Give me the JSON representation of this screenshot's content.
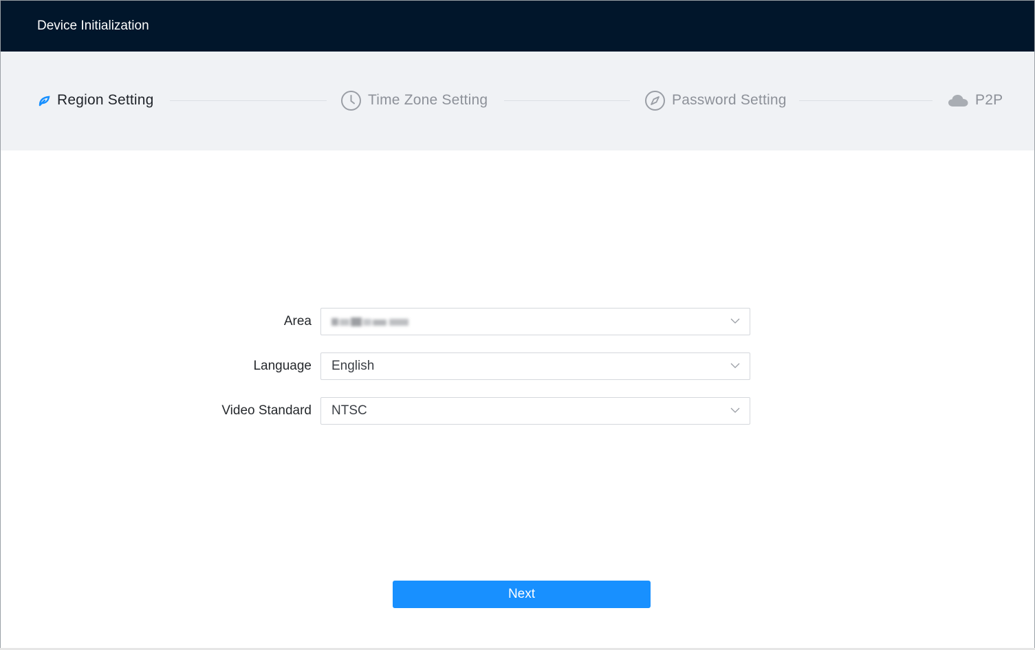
{
  "window": {
    "title": "Device Initialization"
  },
  "steps": [
    {
      "label": "Region Setting",
      "icon": "leaf-icon",
      "active": true
    },
    {
      "label": "Time Zone Setting",
      "icon": "clock-icon",
      "active": false
    },
    {
      "label": "Password Setting",
      "icon": "compass-icon",
      "active": false
    },
    {
      "label": "P2P",
      "icon": "cloud-icon",
      "active": false
    }
  ],
  "form": {
    "area": {
      "label": "Area",
      "value": ""
    },
    "language": {
      "label": "Language",
      "value": "English"
    },
    "video_standard": {
      "label": "Video Standard",
      "value": "NTSC"
    }
  },
  "actions": {
    "next_label": "Next"
  },
  "colors": {
    "titlebar_bg": "#01162b",
    "accent": "#1890ff",
    "steps_bg": "#f0f2f5"
  }
}
